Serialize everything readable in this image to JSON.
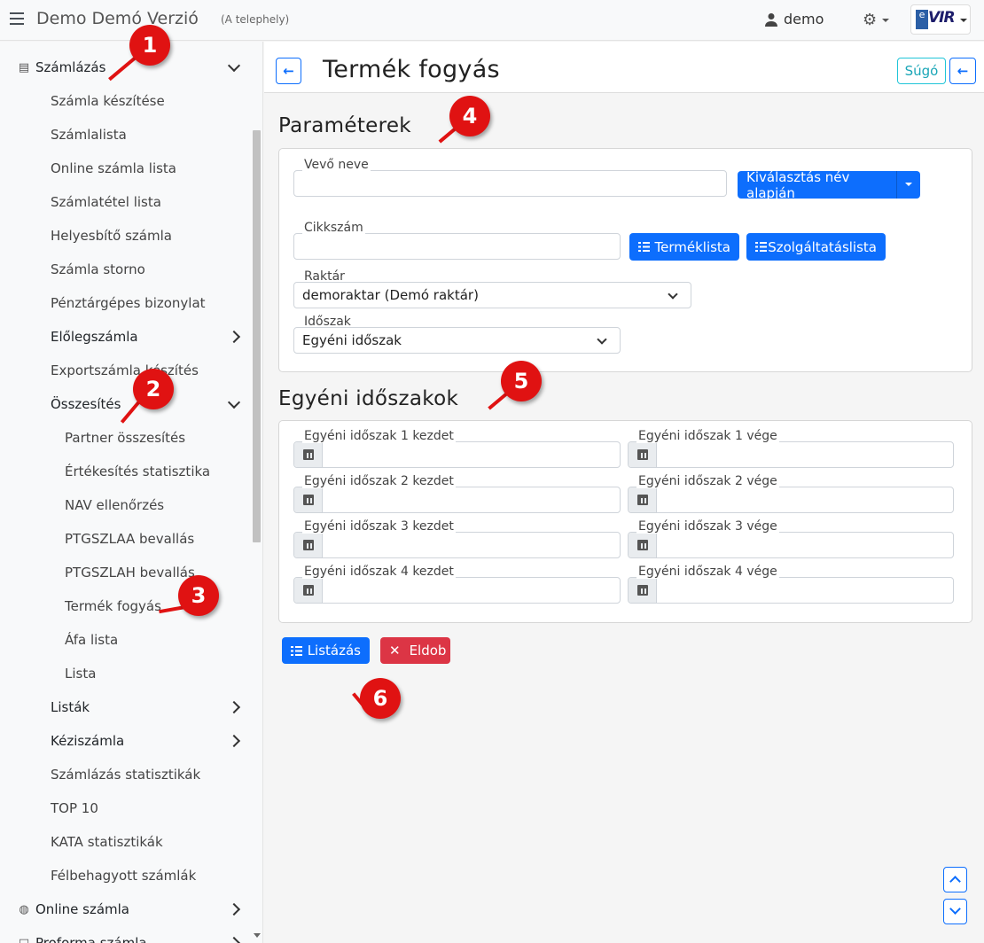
{
  "topbar": {
    "app_title": "Demo Demó Verzió",
    "site": "(A telephely)",
    "user": "demo",
    "logo_text": "VIR",
    "logo_prefix": "e"
  },
  "sidebar": {
    "items": [
      {
        "label": "Számlázás",
        "icon": "document-icon"
      },
      {
        "label": "Számla készítése"
      },
      {
        "label": "Számlalista"
      },
      {
        "label": "Online számla lista"
      },
      {
        "label": "Számlatétel lista"
      },
      {
        "label": "Helyesbítő számla"
      },
      {
        "label": "Számla storno"
      },
      {
        "label": "Pénztárgépes bizonylat"
      },
      {
        "label": "Előlegszámla"
      },
      {
        "label": "Exportszámla készítés"
      },
      {
        "label": "Összesítés"
      },
      {
        "label": "Partner összesítés"
      },
      {
        "label": "Értékesítés statisztika"
      },
      {
        "label": "NAV ellenőrzés"
      },
      {
        "label": "PTGSZLAA bevallás"
      },
      {
        "label": "PTGSZLAH bevallás"
      },
      {
        "label": "Termék fogyás"
      },
      {
        "label": "Áfa lista"
      },
      {
        "label": "Lista"
      },
      {
        "label": "Listák"
      },
      {
        "label": "Kéziszámla"
      },
      {
        "label": "Számlázás statisztikák"
      },
      {
        "label": "TOP 10"
      },
      {
        "label": "KATA statisztikák"
      },
      {
        "label": "Félbehagyott számlák"
      },
      {
        "label": "Online számla",
        "icon": "globe-icon"
      },
      {
        "label": "Proforma számla",
        "icon": "square-icon"
      }
    ]
  },
  "page": {
    "title": "Termék fogyás",
    "help_label": "Súgó"
  },
  "params": {
    "title": "Paraméterek",
    "buyer_label": "Vevő neve",
    "buyer_value": "",
    "select_by_name": "Kiválasztás név alapján",
    "sku_label": "Cikkszám",
    "sku_value": "",
    "product_list": "Terméklista",
    "service_list": "Szolgáltatáslista",
    "warehouse_label": "Raktár",
    "warehouse_value": "demoraktar (Demó raktár)",
    "period_label": "Időszak",
    "period_value": "Egyéni időszak"
  },
  "custom_periods": {
    "title": "Egyéni időszakok",
    "rows": [
      {
        "start": "Egyéni időszak 1 kezdet",
        "end": "Egyéni időszak 1 vége"
      },
      {
        "start": "Egyéni időszak 2 kezdet",
        "end": "Egyéni időszak 2 vége"
      },
      {
        "start": "Egyéni időszak 3 kezdet",
        "end": "Egyéni időszak 3 vége"
      },
      {
        "start": "Egyéni időszak 4 kezdet",
        "end": "Egyéni időszak 4 vége"
      }
    ]
  },
  "actions": {
    "list": "Listázás",
    "discard": "Eldob"
  },
  "markers": [
    "1",
    "2",
    "3",
    "4",
    "5",
    "6"
  ],
  "colors": {
    "primary": "#0d6efd",
    "danger": "#dc3545",
    "marker": "#e01212",
    "help": "#20c5d8"
  }
}
